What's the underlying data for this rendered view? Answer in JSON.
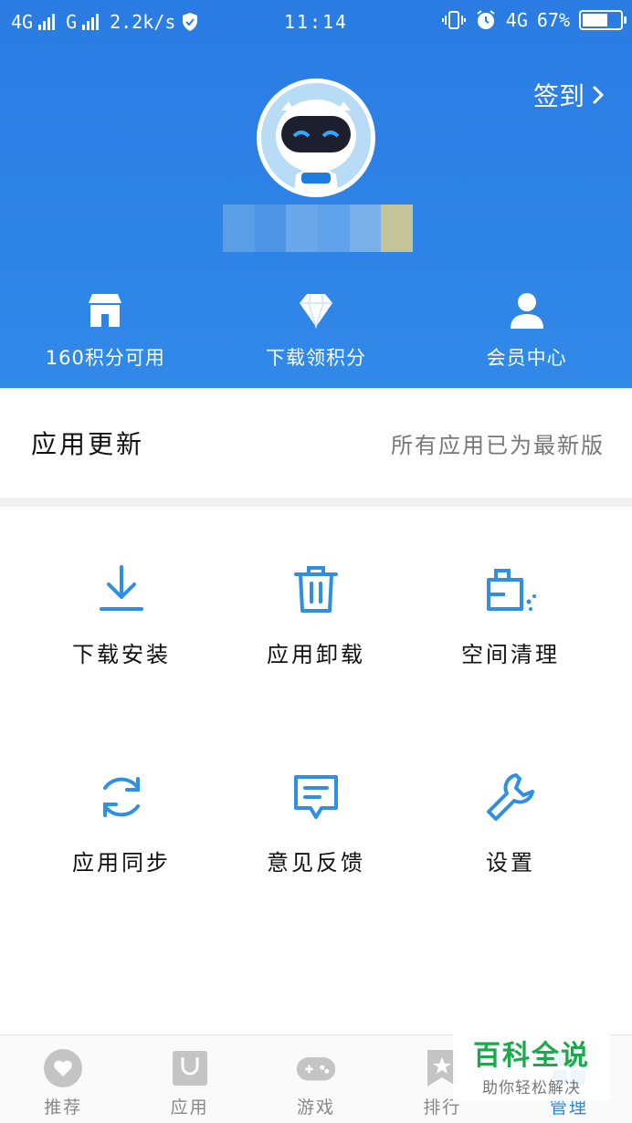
{
  "status_bar": {
    "network_left": "4G",
    "network_second": "G",
    "speed": "2.2k/s",
    "time": "11:14",
    "network_right": "4G",
    "battery": "67%",
    "battery_level": 0.67
  },
  "header": {
    "checkin_label": "签到",
    "actions": [
      {
        "label": "160积分可用",
        "icon": "store-icon"
      },
      {
        "label": "下载领积分",
        "icon": "diamond-icon"
      },
      {
        "label": "会员中心",
        "icon": "person-icon"
      }
    ]
  },
  "update": {
    "title": "应用更新",
    "status": "所有应用已为最新版"
  },
  "grid": [
    {
      "label": "下载安装",
      "icon": "download-icon"
    },
    {
      "label": "应用卸载",
      "icon": "trash-icon"
    },
    {
      "label": "空间清理",
      "icon": "clean-icon"
    },
    {
      "label": "应用同步",
      "icon": "sync-icon"
    },
    {
      "label": "意见反馈",
      "icon": "feedback-icon"
    },
    {
      "label": "设置",
      "icon": "wrench-icon"
    }
  ],
  "bottom_nav": [
    {
      "label": "推荐",
      "icon": "heart-icon"
    },
    {
      "label": "应用",
      "icon": "bag-icon"
    },
    {
      "label": "游戏",
      "icon": "gamepad-icon"
    },
    {
      "label": "排行",
      "icon": "ranking-icon"
    },
    {
      "label": "管理",
      "icon": "manage-icon",
      "active": true
    }
  ],
  "watermark": {
    "title": "百科全说",
    "subtitle": "助你轻松解决"
  },
  "colors": {
    "header_blue": "#2e83e6",
    "icon_blue": "#2e8fe3",
    "watermark_green": "#1ba94c"
  }
}
